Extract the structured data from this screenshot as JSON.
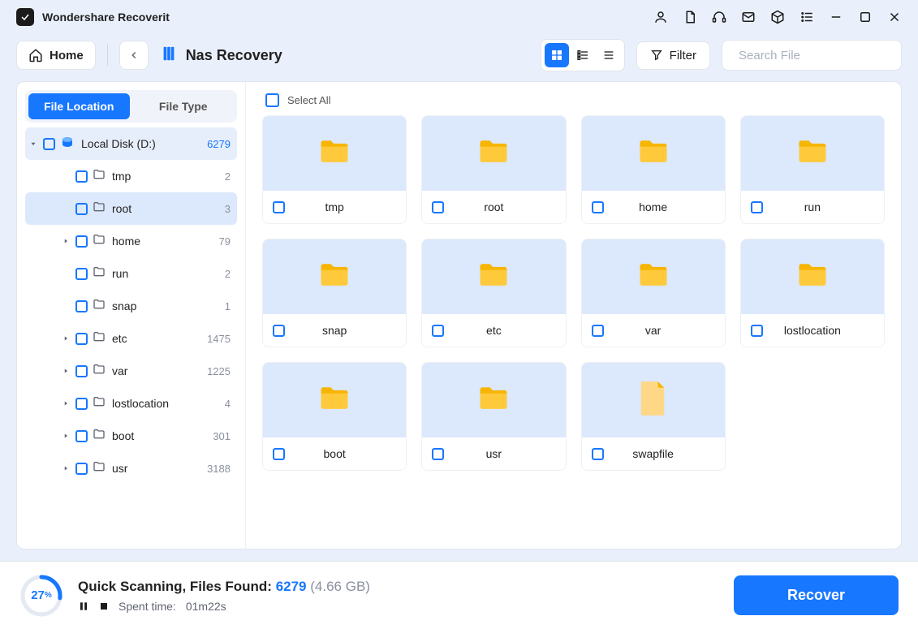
{
  "app": {
    "title": "Wondershare Recoverit"
  },
  "toolbar": {
    "home_label": "Home",
    "breadcrumb_title": "Nas Recovery",
    "filter_label": "Filter",
    "search_placeholder": "Search File"
  },
  "sidebar_tabs": {
    "file_location": "File Location",
    "file_type": "File Type"
  },
  "tree": {
    "root": {
      "label": "Local Disk (D:)",
      "count": "6279"
    },
    "items": [
      {
        "label": "tmp",
        "count": "2",
        "caret": false
      },
      {
        "label": "root",
        "count": "3",
        "caret": false,
        "selected": true
      },
      {
        "label": "home",
        "count": "79",
        "caret": true
      },
      {
        "label": "run",
        "count": "2",
        "caret": false
      },
      {
        "label": "snap",
        "count": "1",
        "caret": false
      },
      {
        "label": "etc",
        "count": "1475",
        "caret": true
      },
      {
        "label": "var",
        "count": "1225",
        "caret": true
      },
      {
        "label": "lostlocation",
        "count": "4",
        "caret": true
      },
      {
        "label": "boot",
        "count": "301",
        "caret": true
      },
      {
        "label": "usr",
        "count": "3188",
        "caret": true
      }
    ]
  },
  "content": {
    "select_all_label": "Select All",
    "grid": [
      {
        "name": "tmp",
        "type": "folder"
      },
      {
        "name": "root",
        "type": "folder"
      },
      {
        "name": "home",
        "type": "folder"
      },
      {
        "name": "run",
        "type": "folder"
      },
      {
        "name": "snap",
        "type": "folder"
      },
      {
        "name": "etc",
        "type": "folder"
      },
      {
        "name": "var",
        "type": "folder"
      },
      {
        "name": "lostlocation",
        "type": "folder"
      },
      {
        "name": "boot",
        "type": "folder"
      },
      {
        "name": "usr",
        "type": "folder"
      },
      {
        "name": "swapfile",
        "type": "file"
      }
    ]
  },
  "footer": {
    "progress_pct": "27",
    "status_prefix": "Quick Scanning, Files Found: ",
    "files_found": "6279",
    "size": "(4.66 GB)",
    "spent_time_label": "Spent time:",
    "spent_time_value": "01m22s",
    "recover_label": "Recover"
  }
}
